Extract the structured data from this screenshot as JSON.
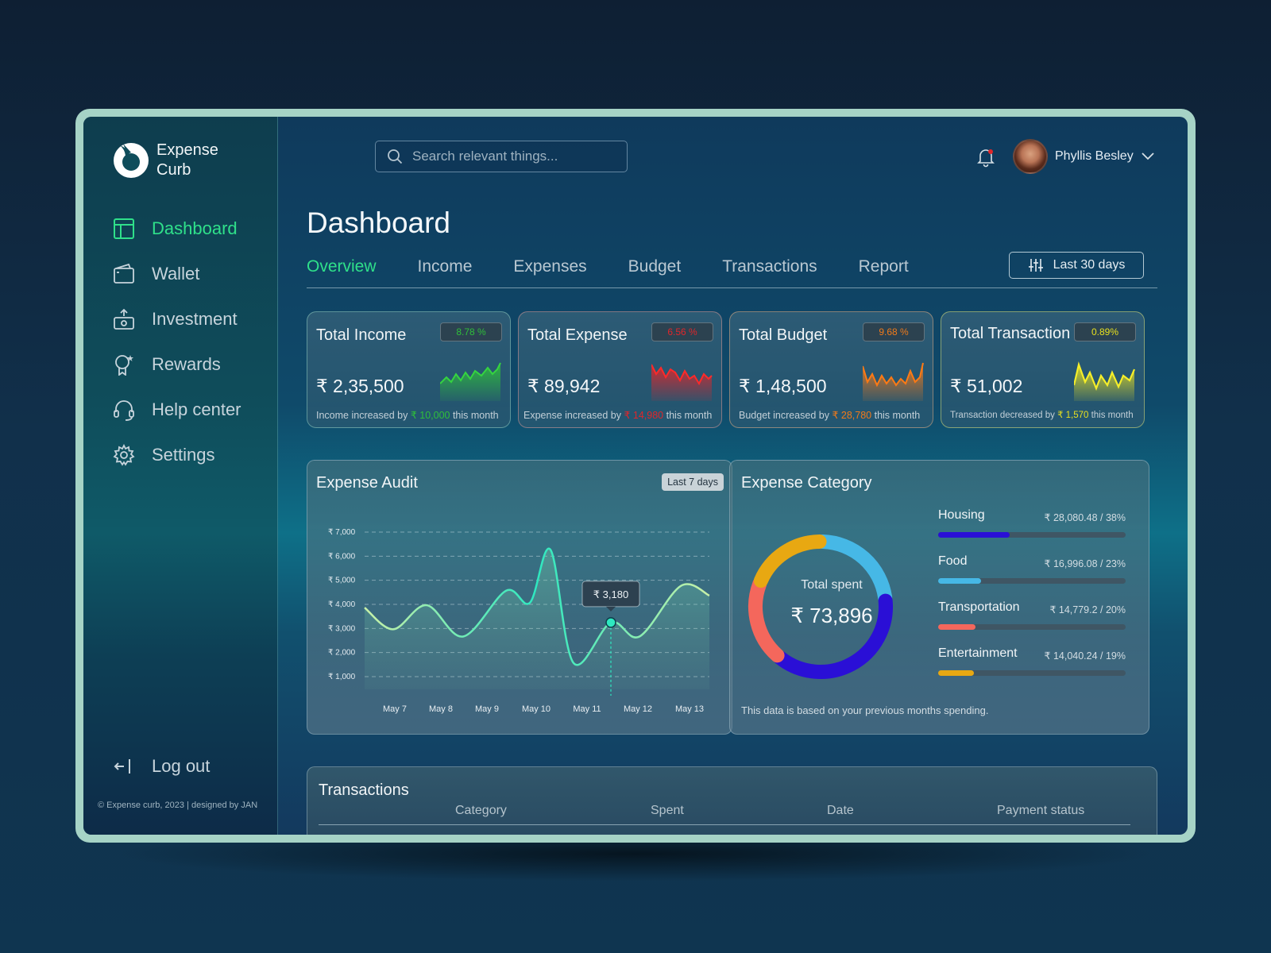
{
  "brand": {
    "line1": "Expense",
    "line2": "Curb"
  },
  "sidebar": {
    "items": [
      {
        "label": "Dashboard",
        "icon": "dashboard-icon",
        "active": true
      },
      {
        "label": "Wallet",
        "icon": "wallet-icon"
      },
      {
        "label": "Investment",
        "icon": "investment-icon"
      },
      {
        "label": "Rewards",
        "icon": "rewards-icon"
      },
      {
        "label": "Help center",
        "icon": "headset-icon"
      },
      {
        "label": "Settings",
        "icon": "gear-icon"
      }
    ],
    "logout": "Log out",
    "copyright": "© Expense curb, 2023 | designed by JAN"
  },
  "header": {
    "search_placeholder": "Search relevant things...",
    "user_name": "Phyllis Besley"
  },
  "page": {
    "title": "Dashboard",
    "tabs": [
      "Overview",
      "Income",
      "Expenses",
      "Budget",
      "Transactions",
      "Report"
    ],
    "active_tab": "Overview",
    "range_label": "Last 30 days"
  },
  "cards": [
    {
      "title": "Total Income",
      "badge": "8.78 %",
      "value": "₹ 2,35,500",
      "note_pre": "Income increased by ",
      "note_amount": "₹ 10,000",
      "note_post": " this month",
      "color": "#2fbf3a"
    },
    {
      "title": "Total Expense",
      "badge": "6.56 %",
      "value": "₹ 89,942",
      "note_pre": "Expense increased by ",
      "note_amount": "₹ 14,980",
      "note_post": " this month",
      "color": "#e0262a"
    },
    {
      "title": "Total Budget",
      "badge": "9.68 %",
      "value": "₹ 1,48,500",
      "note_pre": "Budget increased by ",
      "note_amount": "₹ 28,780",
      "note_post": " this month",
      "color": "#f07a1a"
    },
    {
      "title": "Total Transaction",
      "badge": "0.89%",
      "value": "₹ 51,002",
      "note_pre": "Transaction decreased  by ",
      "note_amount": "₹ 1,570",
      "note_post": " this month",
      "color": "#e8e01e"
    }
  ],
  "expense_audit": {
    "title": "Expense Audit",
    "range": "Last 7 days",
    "tooltip": "₹ 3,180",
    "y_ticks": [
      "₹ 7,000",
      "₹ 6,000",
      "₹ 5,000",
      "₹ 4,000",
      "₹ 3,000",
      "₹ 2,000",
      "₹ 1,000"
    ],
    "x_ticks": [
      "May 7",
      "May 8",
      "May 9",
      "May 10",
      "May 11",
      "May 12",
      "May 13"
    ]
  },
  "chart_data": {
    "type": "area",
    "title": "Expense Audit",
    "xlabel": "",
    "ylabel": "",
    "categories": [
      "May 7",
      "May 8",
      "May 9",
      "May 10",
      "May 11",
      "May 12",
      "May 13"
    ],
    "ylim": [
      1000,
      7000
    ],
    "grid": true,
    "series": [
      {
        "values": [
          3200,
          3600,
          3200,
          6150,
          1600,
          3180,
          3050,
          4000
        ]
      }
    ],
    "highlight": {
      "label": "₹ 3,180",
      "value": 3180
    }
  },
  "expense_category": {
    "title": "Expense Category",
    "center_label": "Total spent",
    "center_value": "₹ 73,896",
    "footnote": "This data is based on your previous months spending.",
    "items": [
      {
        "name": "Housing",
        "value": "₹ 28,080.48 / 38%",
        "pct": 38,
        "color": "#2a0fd6"
      },
      {
        "name": "Food",
        "value": "₹ 16,996.08 / 23%",
        "pct": 23,
        "color": "#46b8e6"
      },
      {
        "name": "Transportation",
        "value": "₹ 14,779.2 / 20%",
        "pct": 20,
        "color": "#f4675c"
      },
      {
        "name": "Entertainment",
        "value": "₹ 14,040.24 / 19%",
        "pct": 19,
        "color": "#e8a812"
      }
    ]
  },
  "transactions": {
    "title": "Transactions",
    "columns": [
      "Category",
      "Spent",
      "Date",
      "Payment status"
    ]
  }
}
